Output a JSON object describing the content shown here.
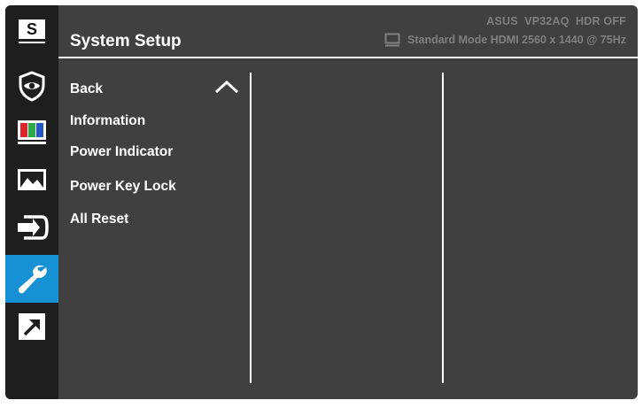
{
  "header": {
    "title": "System Setup",
    "model_line": "ASUS  VP32AQ  HDR OFF",
    "mode_line": "Standard Mode HDMI 2560 x 1440 @ 75Hz",
    "mode_icon": "monitor-icon"
  },
  "sidebar": {
    "items": [
      {
        "name": "splendid",
        "label": "S",
        "icon": "splendid-s-icon"
      },
      {
        "name": "eye-care",
        "icon": "eye-shield-icon"
      },
      {
        "name": "color",
        "icon": "color-bars-icon"
      },
      {
        "name": "image",
        "icon": "image-icon"
      },
      {
        "name": "input-select",
        "icon": "input-icon"
      },
      {
        "name": "system-setup",
        "icon": "wrench-icon",
        "active": true
      },
      {
        "name": "shortcut",
        "icon": "shortcut-arrow-icon"
      }
    ]
  },
  "menu": {
    "items": [
      "Back",
      "Information",
      "Power Indicator",
      "Power Key Lock",
      "All Reset"
    ],
    "scroll_icon": "chevron-up-icon"
  },
  "colors": {
    "sidebar_bg": "#1e1e1e",
    "panel_bg": "#404040",
    "active": "#1591d4",
    "text": "#ffffff",
    "muted": "#7f7f7f"
  }
}
